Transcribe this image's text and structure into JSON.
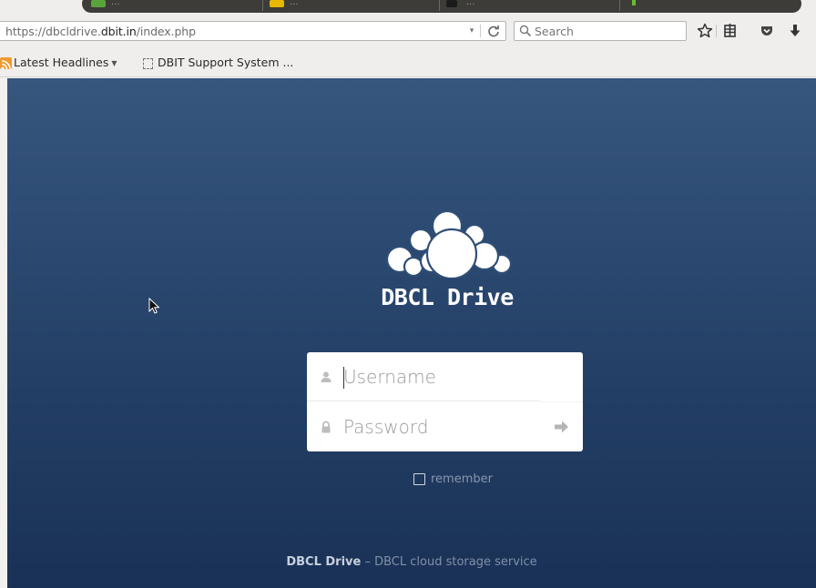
{
  "browser": {
    "tabs": [
      {
        "title": "...",
        "favicon_color": "#5aa53a"
      },
      {
        "title": "...",
        "favicon_color": "#e8b800"
      },
      {
        "title": "...",
        "favicon_color": "#1b1b1b"
      }
    ],
    "url_host_prefix": "https://dbcldrive.",
    "url_host_domain": "dbit.in",
    "url_path": "/index.php",
    "search_placeholder": "Search",
    "toolbar_icons": [
      "bookmark-star-icon",
      "reading-list-icon",
      "pocket-icon",
      "download-icon"
    ],
    "bookmarks": [
      {
        "label": "Latest Headlines",
        "icon": "rss-icon"
      },
      {
        "label": "DBIT Support System ...",
        "icon": "page-icon"
      }
    ]
  },
  "login": {
    "brand": "DBCL Drive",
    "username_placeholder": "Username",
    "password_placeholder": "Password",
    "remember_label": "remember",
    "remember_checked": false,
    "footer_name": "DBCL Drive",
    "footer_tagline": " – DBCL cloud storage service"
  },
  "colors": {
    "page_gradient_top": "#37577e",
    "page_gradient_bottom": "#1a3156",
    "login_box": "#ffffff",
    "rss": "#f19a2a"
  }
}
